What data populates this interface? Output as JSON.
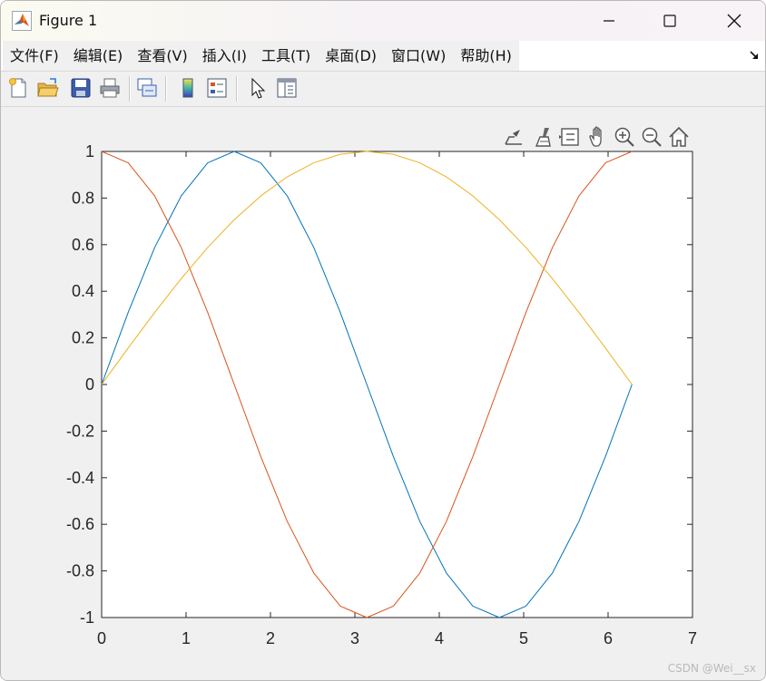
{
  "window": {
    "title": "Figure 1",
    "icon": "matlab-icon",
    "controls": [
      "minimize-icon",
      "maximize-icon",
      "close-icon"
    ]
  },
  "menu": {
    "items": [
      {
        "label": "文件(F)"
      },
      {
        "label": "编辑(E)"
      },
      {
        "label": "查看(V)"
      },
      {
        "label": "插入(I)"
      },
      {
        "label": "工具(T)"
      },
      {
        "label": "桌面(D)"
      },
      {
        "label": "窗口(W)"
      },
      {
        "label": "帮助(H)"
      }
    ],
    "dock_icon": "dock-arrow-icon"
  },
  "toolbar": {
    "buttons": [
      "new-figure-icon",
      "open-file-icon",
      "save-icon",
      "print-icon",
      "link-plot-icon",
      "insert-colorbar-icon",
      "insert-legend-icon",
      "edit-plot-icon",
      "property-inspector-icon"
    ]
  },
  "axes_toolbar": {
    "buttons": [
      "export-icon",
      "brush-icon",
      "data-tips-icon",
      "pan-icon",
      "zoom-in-icon",
      "zoom-out-icon",
      "home-icon"
    ]
  },
  "chart_data": {
    "type": "line",
    "title": "",
    "xlabel": "",
    "ylabel": "",
    "xlim": [
      0,
      7
    ],
    "ylim": [
      -1,
      1
    ],
    "xticks": [
      "0",
      "1",
      "2",
      "3",
      "4",
      "5",
      "6",
      "7"
    ],
    "yticks": [
      "-1",
      "-0.8",
      "-0.6",
      "-0.4",
      "-0.2",
      "0",
      "0.2",
      "0.4",
      "0.6",
      "0.8",
      "1"
    ],
    "grid": false,
    "legend": "none",
    "x": [
      0,
      0.3142,
      0.6283,
      0.9425,
      1.2566,
      1.5708,
      1.885,
      2.1991,
      2.5133,
      2.8274,
      3.1416,
      3.4558,
      3.7699,
      4.0841,
      4.3982,
      4.7124,
      5.0265,
      5.3407,
      5.6549,
      5.969,
      6.2832
    ],
    "series": [
      {
        "color": "#0072BD",
        "values": [
          0,
          0.309,
          0.5878,
          0.809,
          0.9511,
          1,
          0.9511,
          0.809,
          0.5878,
          0.309,
          0,
          -0.309,
          -0.5878,
          -0.809,
          -0.9511,
          -1,
          -0.9511,
          -0.809,
          -0.5878,
          -0.309,
          0
        ]
      },
      {
        "color": "#D95319",
        "values": [
          1,
          0.9511,
          0.809,
          0.5878,
          0.309,
          0,
          -0.309,
          -0.5878,
          -0.809,
          -0.9511,
          -1,
          -0.9511,
          -0.809,
          -0.5878,
          -0.309,
          0,
          0.309,
          0.5878,
          0.809,
          0.9511,
          1
        ]
      },
      {
        "color": "#EDB120",
        "values": [
          0,
          0.1564,
          0.309,
          0.454,
          0.5878,
          0.7071,
          0.809,
          0.891,
          0.9511,
          0.9877,
          1,
          0.9877,
          0.9511,
          0.891,
          0.809,
          0.7071,
          0.5878,
          0.454,
          0.309,
          0.1564,
          0
        ]
      }
    ]
  },
  "watermark": "CSDN @Wei__sx"
}
